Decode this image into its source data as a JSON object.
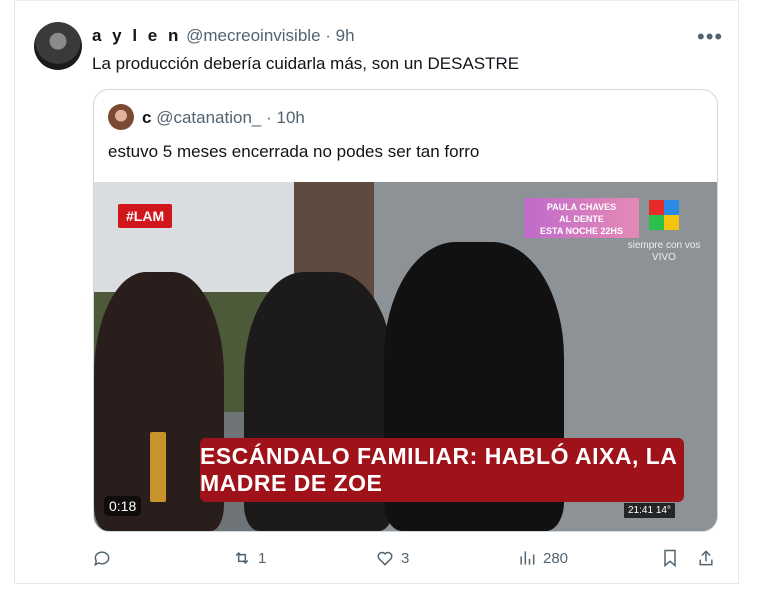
{
  "tweet": {
    "display_name": "a y l e n",
    "handle": "@mecreoinvisible",
    "separator": "·",
    "time": "9h",
    "more_icon": "more-icon",
    "text": "La producción debería cuidarla más, son un DESASTRE"
  },
  "quote": {
    "display_name": "c",
    "handle": "@catanation_",
    "separator": "·",
    "time": "10h",
    "text": "estuvo 5 meses encerrada no podes ser tan forro",
    "video": {
      "tag": "#LAM",
      "promo_line1": "PAULA CHAVES",
      "promo_line2": "AL DENTE",
      "promo_line3": "ESTA NOCHE 22HS",
      "channel_tagline": "siempre con vos",
      "live": "VIVO",
      "headline": "ESCÁNDALO FAMILIAR: HABLÓ AIXA, LA MADRE DE ZOE",
      "duration": "0:18",
      "clock": "21:41",
      "temp": "14°"
    }
  },
  "actions": {
    "reply_count": "",
    "retweet_count": "1",
    "like_count": "3",
    "views_count": "280"
  },
  "colors": {
    "accent_red": "#a0121a",
    "muted": "#536471"
  }
}
